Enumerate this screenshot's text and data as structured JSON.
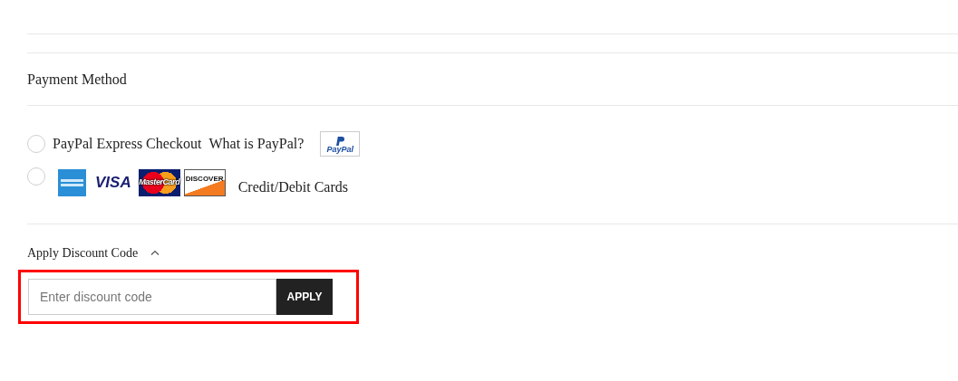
{
  "payment_method": {
    "title": "Payment Method",
    "options": [
      {
        "kind": "paypal",
        "selected": false,
        "label": "PayPal Express Checkout",
        "link": "What is PayPal?",
        "logo": "PayPal"
      },
      {
        "kind": "cards",
        "selected": false,
        "cards": [
          {
            "kind": "amex"
          },
          {
            "kind": "visa",
            "label": "VISA"
          },
          {
            "kind": "mastercard",
            "label": "MasterCard"
          },
          {
            "kind": "discover",
            "label": "DISCOVER"
          }
        ],
        "label": "Credit/Debit Cards"
      }
    ]
  },
  "discount": {
    "title": "Apply Discount Code",
    "expanded": true,
    "placeholder": "Enter discount code",
    "button": "APPLY",
    "highlighted": true
  }
}
